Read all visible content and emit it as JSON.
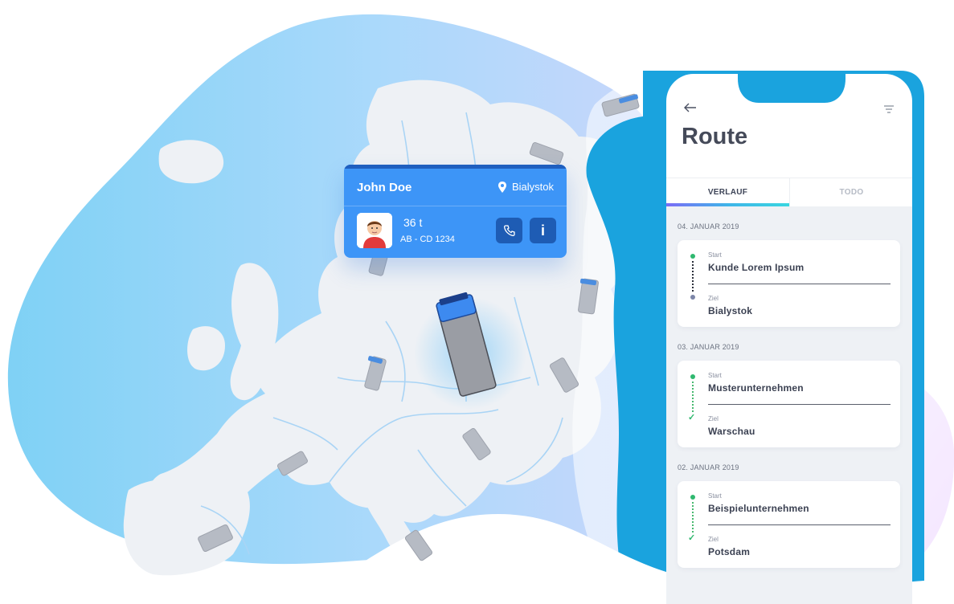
{
  "driver_card": {
    "name": "John Doe",
    "location": "Bialystok",
    "weight": "36 t",
    "plate": "AB - CD 1234"
  },
  "phone": {
    "title": "Route",
    "tabs": [
      {
        "label": "VERLAUF",
        "active": true
      },
      {
        "label": "TODO",
        "active": false
      }
    ],
    "groups": [
      {
        "date": "04. JANUAR 2019",
        "start_label": "Start",
        "start": "Kunde Lorem Ipsum",
        "end_label": "Ziel",
        "end": "Bialystok",
        "completed": false
      },
      {
        "date": "03. JANUAR 2019",
        "start_label": "Start",
        "start": "Musterunternehmen",
        "end_label": "Ziel",
        "end": "Warschau",
        "completed": true
      },
      {
        "date": "02. JANUAR 2019",
        "start_label": "Start",
        "start": "Beispielunternehmen",
        "end_label": "Ziel",
        "end": "Potsdam",
        "completed": true
      }
    ]
  },
  "colors": {
    "brand_blue": "#3d95f7",
    "phone_frame": "#1aa3de",
    "progress_green": "#2fb86f"
  }
}
